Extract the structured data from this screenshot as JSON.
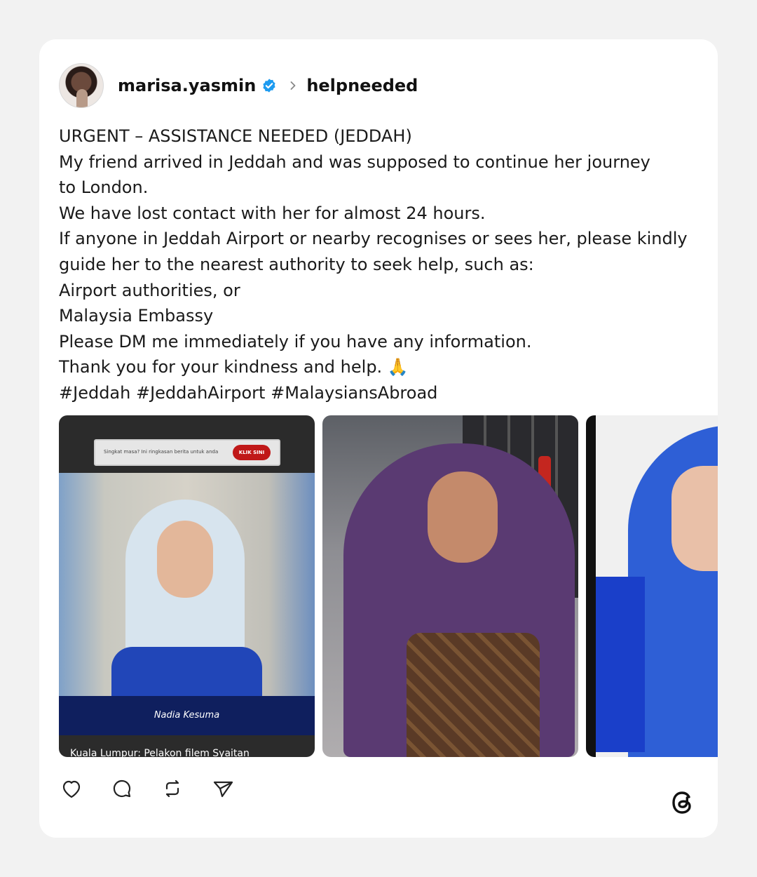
{
  "post": {
    "author": "marisa.yasmin",
    "verified": true,
    "topic": "helpneeded",
    "text_lines": [
      "URGENT – ASSISTANCE NEEDED (JEDDAH)",
      "My friend arrived in Jeddah and was supposed to continue her journey",
      "to London.",
      "We have lost contact with her for almost 24 hours.",
      "If anyone in Jeddah Airport or nearby recognises or sees her, please kindly",
      "guide her to the nearest authority to seek help, such as:",
      "Airport authorities, or",
      "Malaysia Embassy",
      "Please DM me immediately if you have any information.",
      "Thank you for your kindness and help. 🙏",
      "#Jeddah #JeddahAirport #MalaysiansAbroad"
    ],
    "images": {
      "first": {
        "banner_text": "Singkat masa? Ini ringkasan berita untuk anda",
        "banner_button": "KLIK SINI",
        "name_label": "Nadia Kesuma",
        "caption": "Kuala Lumpur: Pelakon filem Syaitan"
      }
    }
  },
  "actions": {
    "like": "heart-icon",
    "comment": "comment-icon",
    "repost": "repost-icon",
    "share": "send-icon"
  },
  "brand": "threads-logo",
  "colors": {
    "verified": "#1d9bf0",
    "text": "#1a1a1a",
    "card": "#ffffff",
    "background": "#f2f2f2"
  }
}
